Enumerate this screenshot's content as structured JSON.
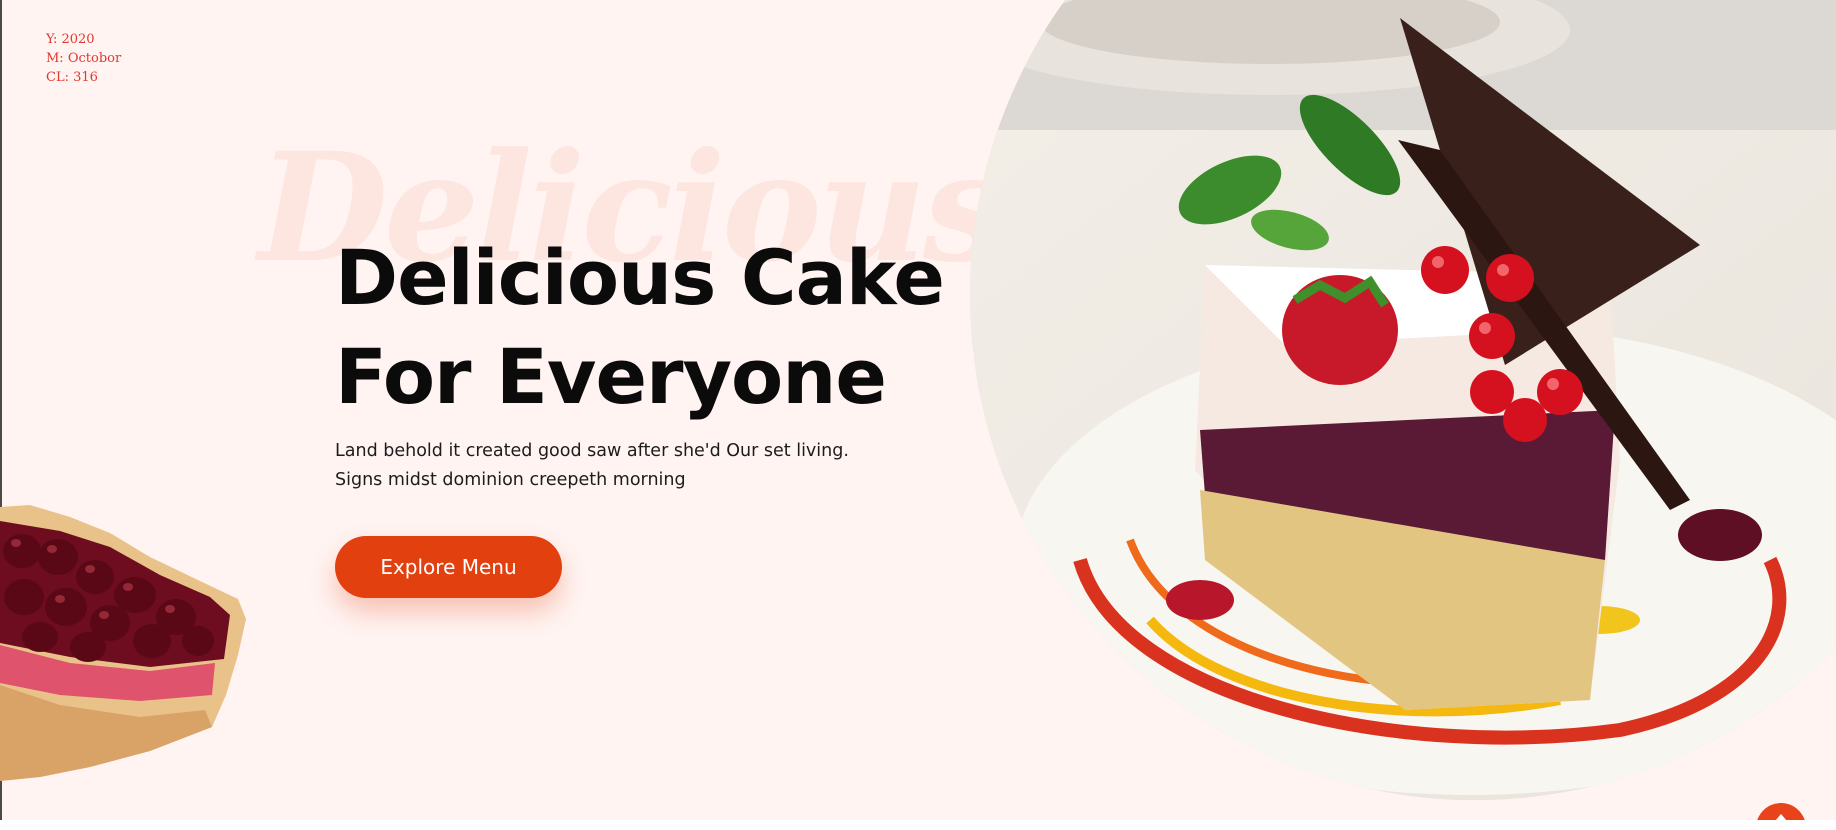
{
  "debug": {
    "year": "Y: 2020",
    "month": "M: Octobor",
    "cl": "CL: 316"
  },
  "hero": {
    "background_word": "Delicious",
    "title": "Delicious Cake For Everyone",
    "description": "Land behold it created good saw after she'd Our set living. Signs midst dominion creepeth morning",
    "cta_label": "Explore Menu"
  },
  "images": {
    "main": "cake-slice-photo",
    "side": "berry-tart-photo"
  },
  "icons": {
    "scroll_top": "arrow-up-icon"
  },
  "colors": {
    "page_background": "#fff4f2",
    "accent": "#e3400f",
    "heading": "#0b0b0b",
    "debug_text": "#e2382d",
    "background_word": "#fde6e0"
  }
}
